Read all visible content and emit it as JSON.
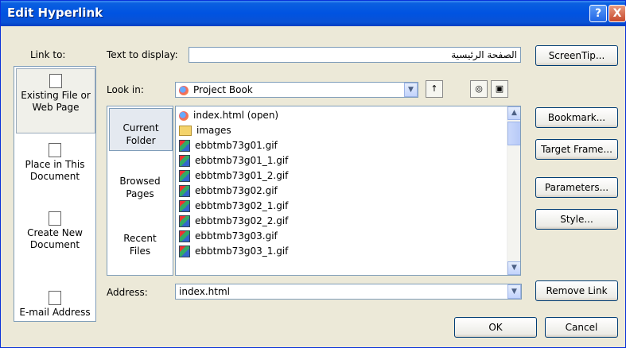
{
  "window": {
    "title": "Edit Hyperlink",
    "help_glyph": "?",
    "close_glyph": "X"
  },
  "labels": {
    "link_to": "Link to:",
    "text_to_display": "Text to display:",
    "look_in": "Look in:",
    "address": "Address:"
  },
  "text_to_display_value": "الصفحة الرئيسية",
  "look_in_value": "Project Book",
  "address_value": "index.html",
  "link_to_items": [
    {
      "label1": "Existing File or",
      "label2": "Web Page",
      "icon": "existing-file-icon"
    },
    {
      "label1": "Place in This",
      "label2": "Document",
      "icon": "place-in-document-icon"
    },
    {
      "label1": "Create New",
      "label2": "Document",
      "icon": "create-new-document-icon"
    },
    {
      "label1": "E-mail Address",
      "label2": "",
      "icon": "email-address-icon"
    }
  ],
  "sub_nav": [
    {
      "label1": "Current",
      "label2": "Folder"
    },
    {
      "label1": "Browsed",
      "label2": "Pages"
    },
    {
      "label1": "Recent",
      "label2": "Files"
    }
  ],
  "files": [
    {
      "name": "index.html (open)",
      "icon": "browser-icon"
    },
    {
      "name": "images",
      "icon": "folder-icon"
    },
    {
      "name": "ebbtmb73g01.gif",
      "icon": "gif-file-icon"
    },
    {
      "name": "ebbtmb73g01_1.gif",
      "icon": "gif-file-icon"
    },
    {
      "name": "ebbtmb73g01_2.gif",
      "icon": "gif-file-icon"
    },
    {
      "name": "ebbtmb73g02.gif",
      "icon": "gif-file-icon"
    },
    {
      "name": "ebbtmb73g02_1.gif",
      "icon": "gif-file-icon"
    },
    {
      "name": "ebbtmb73g02_2.gif",
      "icon": "gif-file-icon"
    },
    {
      "name": "ebbtmb73g03.gif",
      "icon": "gif-file-icon"
    },
    {
      "name": "ebbtmb73g03_1.gif",
      "icon": "gif-file-icon"
    }
  ],
  "buttons": {
    "screentip": "ScreenTip...",
    "bookmark": "Bookmark...",
    "target_frame": "Target Frame...",
    "parameters": "Parameters...",
    "style": "Style...",
    "remove_link": "Remove Link",
    "ok": "OK",
    "cancel": "Cancel"
  },
  "colors": {
    "titlebar": "#0053e1",
    "dialog": "#ece9d8",
    "border": "#7f9db9"
  }
}
